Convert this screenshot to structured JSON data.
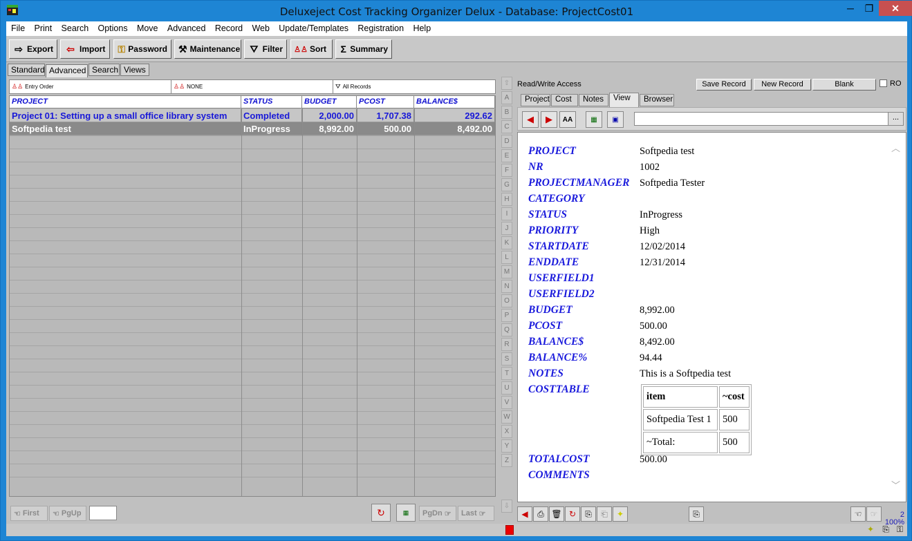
{
  "window": {
    "title": "Deluxeject Cost Tracking Organizer Delux - Database: ProjectCost01",
    "minimize": "─",
    "restore": "❐",
    "close": "✕"
  },
  "menu": [
    "File",
    "Print",
    "Search",
    "Options",
    "Move",
    "Advanced",
    "Record",
    "Web",
    "Update/Templates",
    "Registration",
    "Help"
  ],
  "toolbar": [
    {
      "label": "Export",
      "icon": "export-icon"
    },
    {
      "label": "Import",
      "icon": "import-icon"
    },
    {
      "label": "Password",
      "icon": "key-icon"
    },
    {
      "label": "Maintenance",
      "icon": "tools-icon"
    },
    {
      "label": "Filter",
      "icon": "filter-icon"
    },
    {
      "label": "Sort",
      "icon": "sort-icon"
    },
    {
      "label": "Summary",
      "icon": "sigma-icon"
    }
  ],
  "view_tabs": [
    "Standard",
    "Advanced",
    "Search",
    "Views"
  ],
  "active_view_tab": "Advanced",
  "filterbar": {
    "order": "Entry Order",
    "filter": "NONE",
    "records": "All Records"
  },
  "grid": {
    "headers": [
      "PROJECT",
      "STATUS",
      "BUDGET",
      "PCOST",
      "BALANCE$"
    ],
    "rows": [
      [
        "Project 01: Setting up a small office library system",
        "Completed",
        "2,000.00",
        "1,707.38",
        "292.62"
      ],
      [
        "Softpedia test",
        "InProgress",
        "8,992.00",
        "500.00",
        "8,492.00"
      ]
    ]
  },
  "nav": {
    "first": "First",
    "pgup": "PgUp",
    "pgdn": "PgDn",
    "last": "Last"
  },
  "alphabet": [
    "A",
    "B",
    "C",
    "D",
    "E",
    "F",
    "G",
    "H",
    "I",
    "J",
    "K",
    "L",
    "M",
    "N",
    "O",
    "P",
    "Q",
    "R",
    "S",
    "T",
    "U",
    "V",
    "W",
    "X",
    "Y",
    "Z"
  ],
  "right": {
    "access": "Read/Write Access",
    "save": "Save Record",
    "new": "New Record",
    "blank": "Blank",
    "ro": "RO",
    "tabs": [
      "Project",
      "Cost",
      "Notes",
      "View",
      "Browser"
    ],
    "active_tab": "View",
    "dots": "...",
    "fields": [
      {
        "name": "PROJECT",
        "value": "Softpedia test"
      },
      {
        "name": "NR",
        "value": "1002"
      },
      {
        "name": "PROJECTMANAGER",
        "value": "Softpedia Tester"
      },
      {
        "name": "CATEGORY",
        "value": ""
      },
      {
        "name": "STATUS",
        "value": "InProgress"
      },
      {
        "name": "PRIORITY",
        "value": "High"
      },
      {
        "name": "STARTDATE",
        "value": "12/02/2014"
      },
      {
        "name": "ENDDATE",
        "value": "12/31/2014"
      },
      {
        "name": "USERFIELD1",
        "value": ""
      },
      {
        "name": "USERFIELD2",
        "value": ""
      },
      {
        "name": "BUDGET",
        "value": "8,992.00"
      },
      {
        "name": "PCOST",
        "value": "500.00"
      },
      {
        "name": "BALANCE$",
        "value": "8,492.00"
      },
      {
        "name": "BALANCE%",
        "value": "94.44"
      },
      {
        "name": "NOTES",
        "value": "This is a Softpedia test"
      },
      {
        "name": "COSTTABLE",
        "value": ""
      },
      {
        "name": "TOTALCOST",
        "value": "500.00"
      },
      {
        "name": "COMMENTS",
        "value": ""
      }
    ],
    "costtable": {
      "h1": "item",
      "h2": "~cost",
      "r1c1": "Softpedia Test 1",
      "r1c2": "500",
      "r2c1": "~Total:",
      "r2c2": "500"
    }
  },
  "status": {
    "count": "2",
    "zoom": "100%"
  }
}
